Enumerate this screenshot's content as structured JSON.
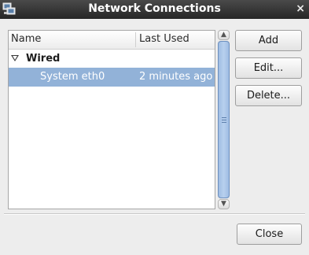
{
  "window": {
    "title": "Network Connections",
    "close_glyph": "×",
    "app_icon": "network-connections-icon"
  },
  "tree": {
    "columns": [
      "Name",
      "Last Used"
    ],
    "groups": [
      {
        "label": "Wired",
        "expanded": true,
        "items": [
          {
            "name": "System eth0",
            "last_used": "2 minutes ago",
            "selected": true
          }
        ]
      }
    ]
  },
  "buttons": {
    "add": "Add",
    "edit": "Edit...",
    "delete": "Delete...",
    "close": "Close"
  },
  "colors": {
    "selection": "#92b2d8",
    "titlebar": "#2e2e2e",
    "scroll_thumb": "#a9c4e8"
  }
}
